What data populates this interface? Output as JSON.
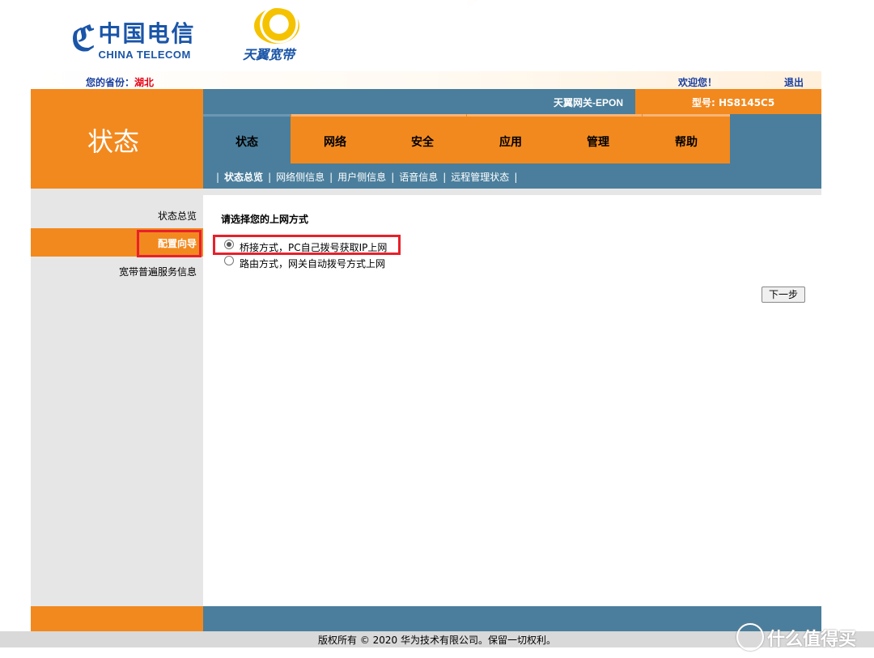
{
  "header": {
    "logo_main_glyph": "ℭ",
    "logo_cn": "中国电信",
    "logo_en": "CHINA TELECOM",
    "logo_sub": "天翼宽带",
    "province_label": "您的省份：",
    "province_value": "湖北",
    "welcome": "欢迎您！",
    "logout": "退出"
  },
  "title_block": {
    "label": "状态"
  },
  "info_bar": {
    "gateway_name": "天翼网关-EPON",
    "model_label": "型号: HS8145C5"
  },
  "nav": {
    "tabs": [
      {
        "label": "状态",
        "active": true
      },
      {
        "label": "网络",
        "active": false
      },
      {
        "label": "安全",
        "active": false
      },
      {
        "label": "应用",
        "active": false
      },
      {
        "label": "管理",
        "active": false
      },
      {
        "label": "帮助",
        "active": false
      }
    ]
  },
  "subnav": {
    "items": [
      "状态总览",
      "网络侧信息",
      "用户侧信息",
      "语音信息",
      "远程管理状态"
    ],
    "separator": "|"
  },
  "sidebar": {
    "items": [
      "状态总览",
      "配置向导",
      "宽带普遍服务信息"
    ],
    "active_index": 1
  },
  "content": {
    "question": "请选择您的上网方式",
    "options": [
      {
        "label": "桥接方式，PC自己拨号获取IP上网",
        "checked": true
      },
      {
        "label": "路由方式，网关自动拨号方式上网",
        "checked": false
      }
    ],
    "next_button": "下一步"
  },
  "footer": {
    "copyright": "版权所有 © 2020 华为技术有限公司。保留一切权利。",
    "watermark": "什么值得买"
  },
  "colors": {
    "orange": "#f2891e",
    "blue": "#4a7e9c",
    "brand_blue": "#1a55a8",
    "highlight_red": "#e8202a"
  }
}
